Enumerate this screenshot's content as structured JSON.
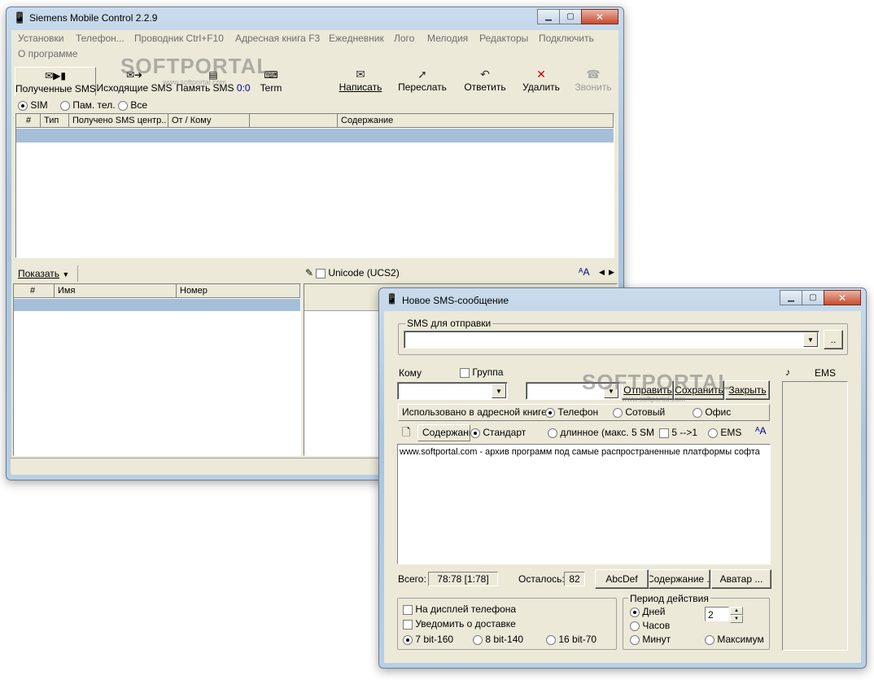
{
  "main": {
    "title": "Siemens Mobile Control 2.2.9",
    "menu": [
      "Установки",
      "Телефон...",
      "Проводник Ctrl+F10",
      "Адресная книга F3",
      "Ежедневник",
      "Лого",
      "Мелодия",
      "Редакторы",
      "Подключить",
      "О программе"
    ],
    "tabs": [
      "Полученные SMS",
      "Исходящие SMS",
      "Память SMS",
      "Term"
    ],
    "memory_count": "0:0",
    "toolbar": [
      "Написать",
      "Переслать",
      "Ответить",
      "Удалить",
      "Звонить"
    ],
    "storage": [
      "SIM",
      "Пам. тел.",
      "Все"
    ],
    "columns": [
      "#",
      "Тип",
      "Получено SMS центр..",
      "От / Кому",
      "",
      "Содержание"
    ],
    "show_label": "Показать",
    "contact_columns": [
      "#",
      "Имя",
      "Номер"
    ],
    "unicode_label": "Unicode (UCS2)"
  },
  "dialog": {
    "title": "Новое SMS-сообщение",
    "sms_group": "SMS для отправки",
    "browse": "..",
    "to_label": "Кому",
    "group_label": "Группа",
    "send": "Отправить",
    "save": "Сохранить",
    "close": "Закрыть",
    "used_label": "Использовано в адресной книге:",
    "used_options": [
      "Телефон",
      "Сотовый",
      "Офис"
    ],
    "content_tab": "Содержание",
    "format_options": [
      "Стандарт",
      "длинное (макс. 5 SM",
      "5 -->1",
      "EMS"
    ],
    "message_text": "www.softportal.com - архив программ под самые распространенные платформы софта",
    "total_label": "Всего:",
    "total_value": "78:78 [1:78]",
    "left_label": "Осталось:",
    "left_value": "82",
    "abc_button": "AbcDef",
    "content_button": "Содержание ..",
    "avatar_button": "Аватар ...",
    "opt_display": "На дисплей телефона",
    "opt_notify": "Уведомить о доставке",
    "encodings": [
      "7 bit-160",
      "8 bit-140",
      "16 bit-70"
    ],
    "period_group": "Период действия",
    "period_units": [
      "Дней",
      "Часов",
      "Минут",
      "Максимум"
    ],
    "period_value": "2",
    "ems_label": "EMS"
  },
  "watermark": {
    "text": "SOFTPORTAL",
    "url": "www.softportal.com"
  }
}
